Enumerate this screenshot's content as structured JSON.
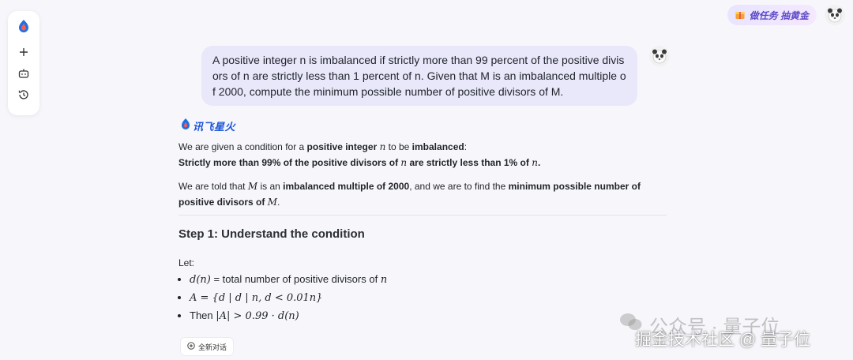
{
  "topbar": {
    "task_label": "做任务 抽黄金"
  },
  "user_message": "A positive integer n is imbalanced if strictly more than 99 percent of the positive divisors of n are strictly less than 1 percent of n. Given that M is an imbalanced multiple of 2000, compute the minimum possible number of positive divisors of M.",
  "brand": {
    "name": "讯飞星火"
  },
  "answer": {
    "p1_pre": "We are given a condition for a ",
    "p1_b1": "positive integer",
    "p1_var": "n",
    "p1_mid": " to be ",
    "p1_b2": "imbalanced",
    "p1_end": ":",
    "p2_b1": "Strictly more than 99% of the positive divisors of ",
    "p2_var1": "n",
    "p2_b2": " are strictly less than 1% of ",
    "p2_var2": "n",
    "p2_end": ".",
    "p3_pre": "We are told that ",
    "p3_var": "M",
    "p3_mid": " is an ",
    "p3_b1": "imbalanced multiple of 2000",
    "p3_mid2": ", and we are to find the ",
    "p3_b2": "minimum possible number of positive divisors of",
    "p3_var2": "M",
    "p3_end": ".",
    "step_title": "Step 1: Understand the condition",
    "let": "Let:",
    "defs": [
      {
        "math": "d(n)",
        "text": " = total number of positive divisors of ",
        "math2": "n"
      },
      {
        "math": "A = {d | d | n,  d < 0.01n}"
      },
      {
        "text_pre": "Then ",
        "math": "|A| > 0.99 · d(n)"
      }
    ]
  },
  "new_chat_label": "全新对话",
  "watermark": {
    "line1": "公众号 · 量子位",
    "line2": "掘金技术社区 @ 量子位"
  },
  "colors": {
    "brand_blue": "#1a55d8",
    "bubble": "#e9e8fb",
    "background": "#f7f7fb"
  }
}
